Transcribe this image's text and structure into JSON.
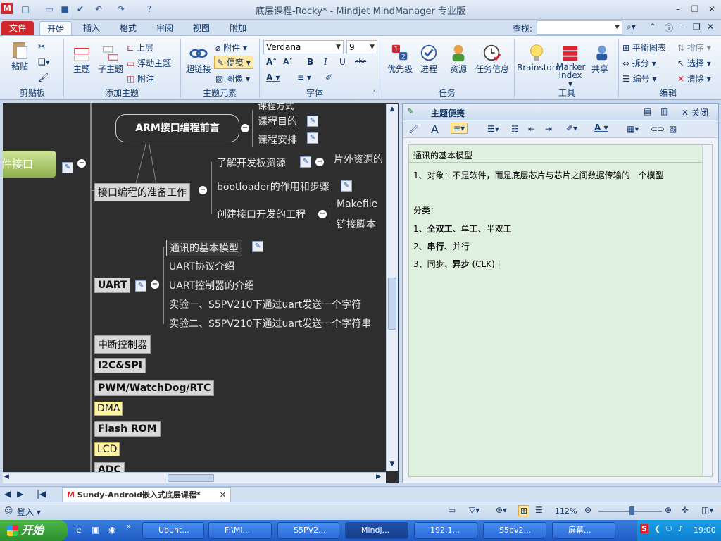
{
  "titlebar": {
    "title": "底层课程-Rocky* - Mindjet MindManager 专业版",
    "app_icon": "M"
  },
  "tabs": [
    "文件",
    "开始",
    "插入",
    "格式",
    "审阅",
    "视图",
    "附加"
  ],
  "search": {
    "label": "查找:"
  },
  "ribbon": {
    "clipboard": {
      "paste": "粘贴",
      "label": "剪贴板"
    },
    "add_topic": {
      "topic": "主题",
      "subtopic": "子主题",
      "parent": "上层",
      "floating": "浮动主题",
      "callout": "附注",
      "label": "添加主题"
    },
    "elements": {
      "hyperlink": "超链接",
      "attachment": "附件",
      "notes": "便笺",
      "image": "图像",
      "label": "主题元素"
    },
    "font": {
      "family": "Verdana",
      "size": "9",
      "label": "字体"
    },
    "task": {
      "priority": "优先级",
      "progress": "进程",
      "resource": "资源",
      "taskinfo": "任务信息",
      "label": "任务"
    },
    "tools": {
      "brainstorm": "Brainstorm",
      "marker1": "Marker",
      "marker2": "Index",
      "share": "共享",
      "label": "工具"
    },
    "edit": {
      "balance": "平衡图表",
      "sort": "排序",
      "split": "拆分",
      "select": "选择",
      "number": "编号",
      "clear": "清除",
      "label": "编辑"
    }
  },
  "map": {
    "central": "件接口",
    "nodes": {
      "prep_title": "ARM接口编程前言",
      "n_method": "课程方式",
      "n_purpose": "课程目的",
      "n_schedule": "课程安排",
      "prep": "接口编程的准备工作",
      "p1": "了解开发板资源",
      "p1a": "片外资源的",
      "p2": "bootloader的作用和步骤",
      "p3": "创建接口开发的工程",
      "p3a": "Makefile",
      "p3b": "链接脚本",
      "uart": "UART",
      "u1": "通讯的基本模型",
      "u2": "UART协议介绍",
      "u3": "UART控制器的介绍",
      "u4": "实验一、S5PV210下通过uart发送一个字符",
      "u5": "实验二、S5PV210下通过uart发送一个字符串",
      "irq": "中断控制器",
      "i2c": "I2C&SPI",
      "pwm": "PWM/WatchDog/RTC",
      "dma": "DMA",
      "flash": "Flash ROM",
      "lcd": "LCD",
      "adc": "ADC"
    }
  },
  "notes": {
    "title": "主题便笺",
    "close": "关闭",
    "topic": "通讯的基本模型",
    "line1": "1、对象：不是软件，而是底层芯片与芯片之间数据传输的一个模型",
    "line2": "分类：",
    "line3a": "1、",
    "line3b": "全双工",
    "line3c": "、单工、半双工",
    "line4a": "2、",
    "line4b": "串行",
    "line4c": "、并行",
    "line5a": "3、同步、",
    "line5b": "异步",
    "line5c": " (CLK)"
  },
  "doctab": {
    "name": "Sundy-Android嵌入式底层课程*"
  },
  "status": {
    "login": "登入",
    "zoom": "112%"
  },
  "taskbar": {
    "start": "开始",
    "items": [
      "Ubunt...",
      "F:\\MI...",
      "S5PV2...",
      "Mindj...",
      "192.1...",
      "S5pv2...",
      "屏幕..."
    ],
    "clock": "19:00"
  },
  "colors": {
    "file_tab": "#d2282d",
    "map_bg": "#2e2e2e",
    "notes_bg": "#dff0df",
    "taskbar": "#1f5bc4"
  }
}
